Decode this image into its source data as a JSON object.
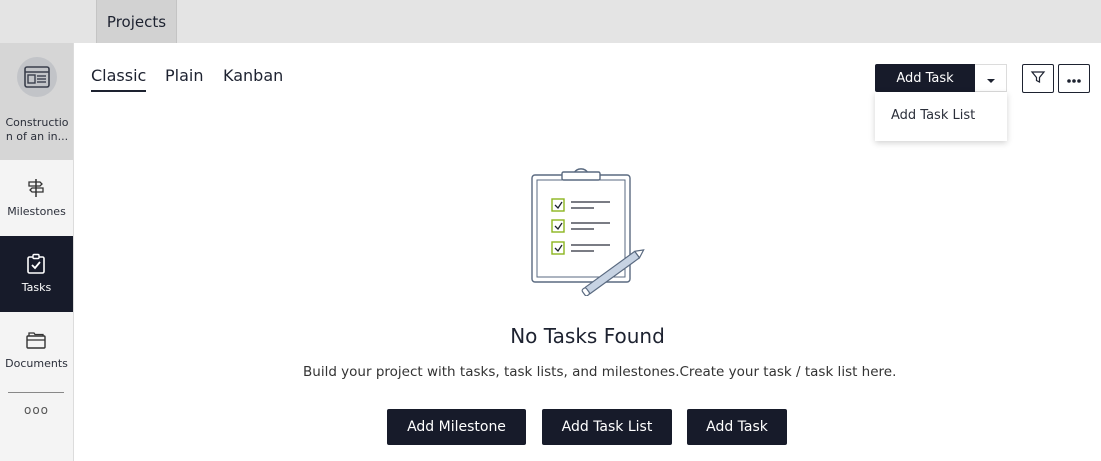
{
  "topbar": {
    "tab_label": "Projects"
  },
  "sidebar": {
    "project_name": "Constructio n of an in...",
    "items": [
      {
        "label": "Milestones",
        "icon": "signpost-icon"
      },
      {
        "label": "Tasks",
        "icon": "clipboard-check-icon",
        "active": true
      },
      {
        "label": "Documents",
        "icon": "folders-icon"
      }
    ],
    "more_label": "ooo"
  },
  "views": {
    "tabs": [
      "Classic",
      "Plain",
      "Kanban"
    ],
    "active": "Classic"
  },
  "actions": {
    "add_task_label": "Add Task",
    "dropdown_items": [
      "Add Task List"
    ]
  },
  "empty_state": {
    "title": "No Tasks Found",
    "description": "Build your project with tasks, task lists, and milestones.Create your task / task list here.",
    "buttons": [
      "Add Milestone",
      "Add Task List",
      "Add Task"
    ]
  },
  "colors": {
    "dark": "#171b2a",
    "accent_check": "#8bb51e",
    "rail_bg": "#f4f4f4"
  }
}
